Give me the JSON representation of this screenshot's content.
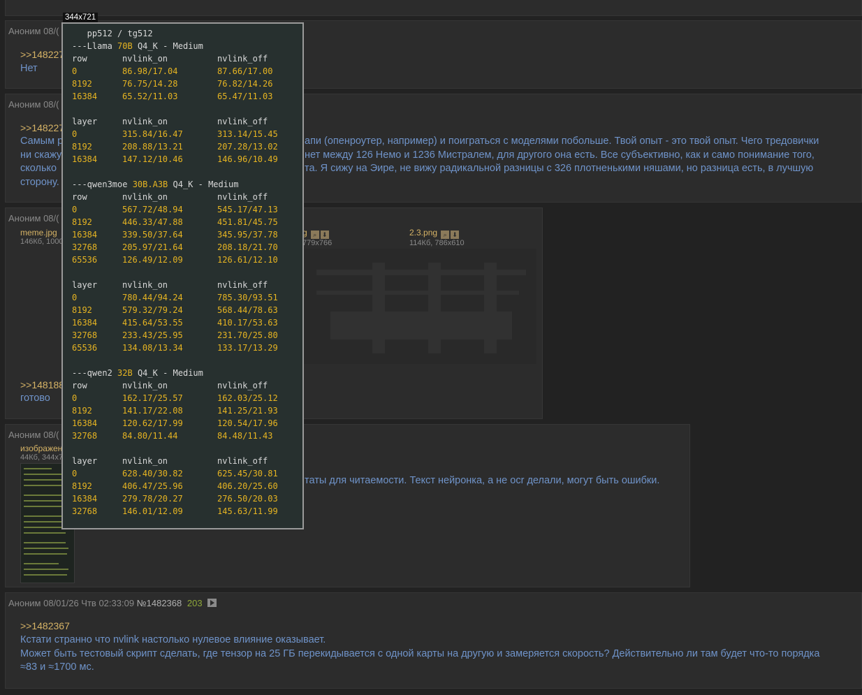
{
  "posts": {
    "p1": {
      "header": "Аноним 08/("
    },
    "p2": {
      "header": "Аноним 08/(",
      "reply": ">>148227",
      "text": "Нет"
    },
    "p3": {
      "header": "Аноним 08/(",
      "reply": ">>148227",
      "lines": [
        "Самым р",
        "ни скажу",
        "сколько",
        "сторону."
      ],
      "right_lines": [
        "апи (опенроутер, например) и поиграться с моделями побольше. Твой опыт - это твой опыт. Чего тредовички",
        "нет между 126 Немо и 1236 Мистралем, для другого она есть. Все субъективно, как и само понимание того,",
        "та. Я сижу на Эире, не вижу радикальной разницы с 326 плотненькими няшами, но разница есть, в лучшую"
      ]
    },
    "p4": {
      "header": "Аноним 08/(",
      "file1": {
        "name": "meme.jpg",
        "info": "146Кб, 1000"
      },
      "file2": {
        "name": "g",
        "info": "779x766"
      },
      "file3": {
        "name": "2.3.png",
        "info": "114Кб, 786x610"
      },
      "reply": ">>148188",
      "text": "готово"
    },
    "p5": {
      "header": "Аноним 08/(",
      "file": {
        "name": "изображен",
        "info": "44Кб, 344x7"
      },
      "text": "таты для читаемости. Текст нейронка, а не осr делали, могут быть ошибки."
    },
    "p6": {
      "header_name": "Аноним",
      "header_date": "08/01/26 Чтв 02:33:09",
      "header_num": "№1482368",
      "count": "203",
      "reply": ">>1482367",
      "lines": [
        "Кстати странно что nvlink настолько нулевое влияние оказывает.",
        "Может быть тестовый скрипт сделать, где тензор на 25 ГБ перекидывается с одной карты на другую и замеряется скорость? Действительно ли там будет что-то порядка",
        "≈83 и ≈1700 мс."
      ]
    }
  },
  "overlay": {
    "size_badge": "344x721",
    "lines": [
      {
        "t": "h",
        "parts": [
          [
            "w",
            "   pp512 / tg512"
          ]
        ]
      },
      {
        "t": "h",
        "parts": [
          [
            "w",
            "---Llama "
          ],
          [
            "y",
            "70B"
          ],
          [
            "w",
            " Q4_K - Medium"
          ]
        ]
      },
      {
        "t": "r",
        "c": [
          "row",
          "nvlink_on",
          "nvlink_off"
        ],
        "hdr": true
      },
      {
        "t": "r",
        "c": [
          "0",
          "86.98/17.04",
          "87.66/17.00"
        ]
      },
      {
        "t": "r",
        "c": [
          "8192",
          "76.75/14.28",
          "76.82/14.26"
        ]
      },
      {
        "t": "r",
        "c": [
          "16384",
          "65.52/11.03",
          "65.47/11.03"
        ]
      },
      {
        "t": "b"
      },
      {
        "t": "r",
        "c": [
          "layer",
          "nvlink_on",
          "nvlink_off"
        ],
        "hdr": true
      },
      {
        "t": "r",
        "c": [
          "0",
          "315.84/16.47",
          "313.14/15.45"
        ]
      },
      {
        "t": "r",
        "c": [
          "8192",
          "208.88/13.21",
          "207.28/13.02"
        ]
      },
      {
        "t": "r",
        "c": [
          "16384",
          "147.12/10.46",
          "146.96/10.49"
        ]
      },
      {
        "t": "b"
      },
      {
        "t": "h",
        "parts": [
          [
            "w",
            "---qwen3moe "
          ],
          [
            "y",
            "30B.A3B"
          ],
          [
            "w",
            " Q4_K - Medium"
          ]
        ]
      },
      {
        "t": "r",
        "c": [
          "row",
          "nvlink_on",
          "nvlink_off"
        ],
        "hdr": true
      },
      {
        "t": "r",
        "c": [
          "0",
          "567.72/48.94",
          "545.17/47.13"
        ]
      },
      {
        "t": "r",
        "c": [
          "8192",
          "446.33/47.88",
          "451.81/45.75"
        ]
      },
      {
        "t": "r",
        "c": [
          "16384",
          "339.50/37.64",
          "345.95/37.78"
        ]
      },
      {
        "t": "r",
        "c": [
          "32768",
          "205.97/21.64",
          "208.18/21.70"
        ]
      },
      {
        "t": "r",
        "c": [
          "65536",
          "126.49/12.09",
          "126.61/12.10"
        ]
      },
      {
        "t": "b"
      },
      {
        "t": "r",
        "c": [
          "layer",
          "nvlink_on",
          "nvlink_off"
        ],
        "hdr": true
      },
      {
        "t": "r",
        "c": [
          "0",
          "780.44/94.24",
          "785.30/93.51"
        ]
      },
      {
        "t": "r",
        "c": [
          "8192",
          "579.32/79.24",
          "568.44/78.63"
        ]
      },
      {
        "t": "r",
        "c": [
          "16384",
          "415.64/53.55",
          "410.17/53.63"
        ]
      },
      {
        "t": "r",
        "c": [
          "32768",
          "233.43/25.95",
          "231.70/25.80"
        ]
      },
      {
        "t": "r",
        "c": [
          "65536",
          "134.08/13.34",
          "133.17/13.29"
        ]
      },
      {
        "t": "b"
      },
      {
        "t": "h",
        "parts": [
          [
            "w",
            "---qwen2 "
          ],
          [
            "y",
            "32B"
          ],
          [
            "w",
            " Q4_K - Medium"
          ]
        ]
      },
      {
        "t": "r",
        "c": [
          "row",
          "nvlink_on",
          "nvlink_off"
        ],
        "hdr": true
      },
      {
        "t": "r",
        "c": [
          "0",
          "162.17/25.57",
          "162.03/25.12"
        ]
      },
      {
        "t": "r",
        "c": [
          "8192",
          "141.17/22.08",
          "141.25/21.93"
        ]
      },
      {
        "t": "r",
        "c": [
          "16384",
          "120.62/17.99",
          "120.54/17.96"
        ]
      },
      {
        "t": "r",
        "c": [
          "32768",
          "84.80/11.44",
          "84.48/11.43"
        ]
      },
      {
        "t": "b"
      },
      {
        "t": "r",
        "c": [
          "layer",
          "nvlink_on",
          "nvlink_off"
        ],
        "hdr": true
      },
      {
        "t": "r",
        "c": [
          "0",
          "628.40/30.82",
          "625.45/30.81"
        ]
      },
      {
        "t": "r",
        "c": [
          "8192",
          "406.47/25.96",
          "406.20/25.60"
        ]
      },
      {
        "t": "r",
        "c": [
          "16384",
          "279.78/20.27",
          "276.50/20.03"
        ]
      },
      {
        "t": "r",
        "c": [
          "32768",
          "146.01/12.09",
          "145.63/11.99"
        ]
      }
    ]
  }
}
